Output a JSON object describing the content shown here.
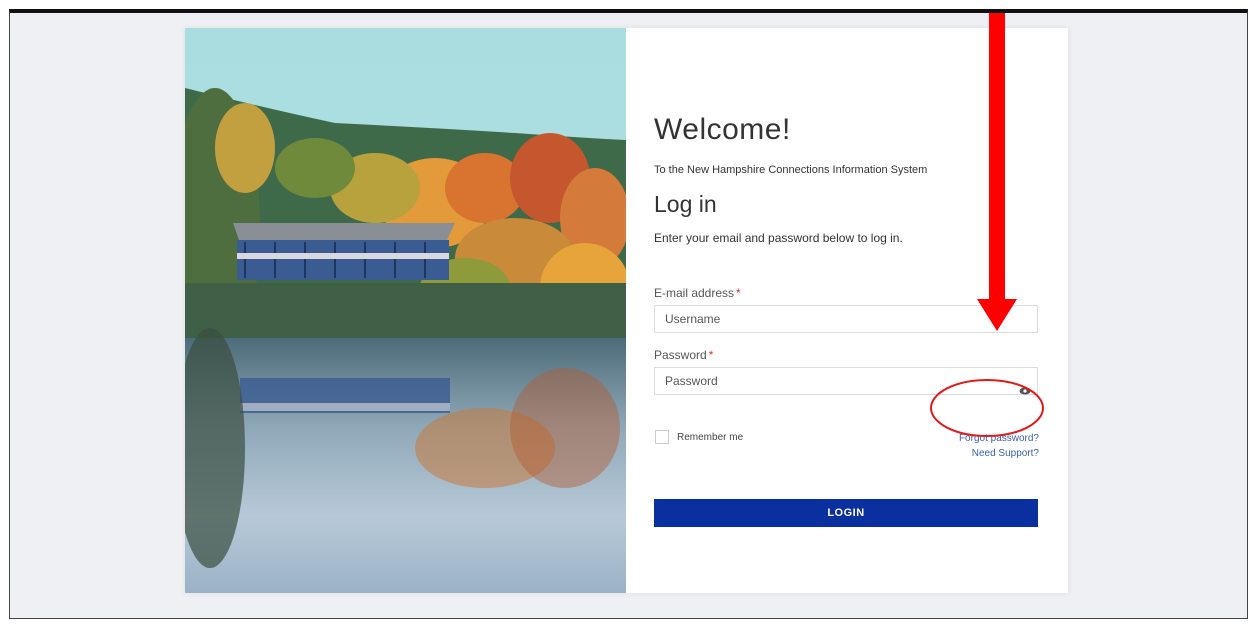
{
  "page": {
    "welcome": "Welcome!",
    "subtitle": "To the New Hampshire Connections Information System",
    "login_heading": "Log in",
    "instructions": "Enter your email and password below to log in."
  },
  "email": {
    "label": "E-mail address",
    "required_mark": "*",
    "placeholder": "Username"
  },
  "password": {
    "label": "Password",
    "required_mark": "*",
    "placeholder": "Password",
    "toggle_icon": "eye-icon"
  },
  "remember": {
    "label": "Remember me",
    "checked": false
  },
  "links": {
    "forgot": "Forgot password?",
    "support": "Need Support?"
  },
  "login_button": "LOGIN",
  "colors": {
    "primary_button": "#0a2f9e",
    "link": "#3a5fb0",
    "annotation": "#ff0000",
    "background": "#eef0f3"
  },
  "annotations": {
    "arrow": "down-arrow-annotation",
    "circle": "circle-annotation"
  }
}
